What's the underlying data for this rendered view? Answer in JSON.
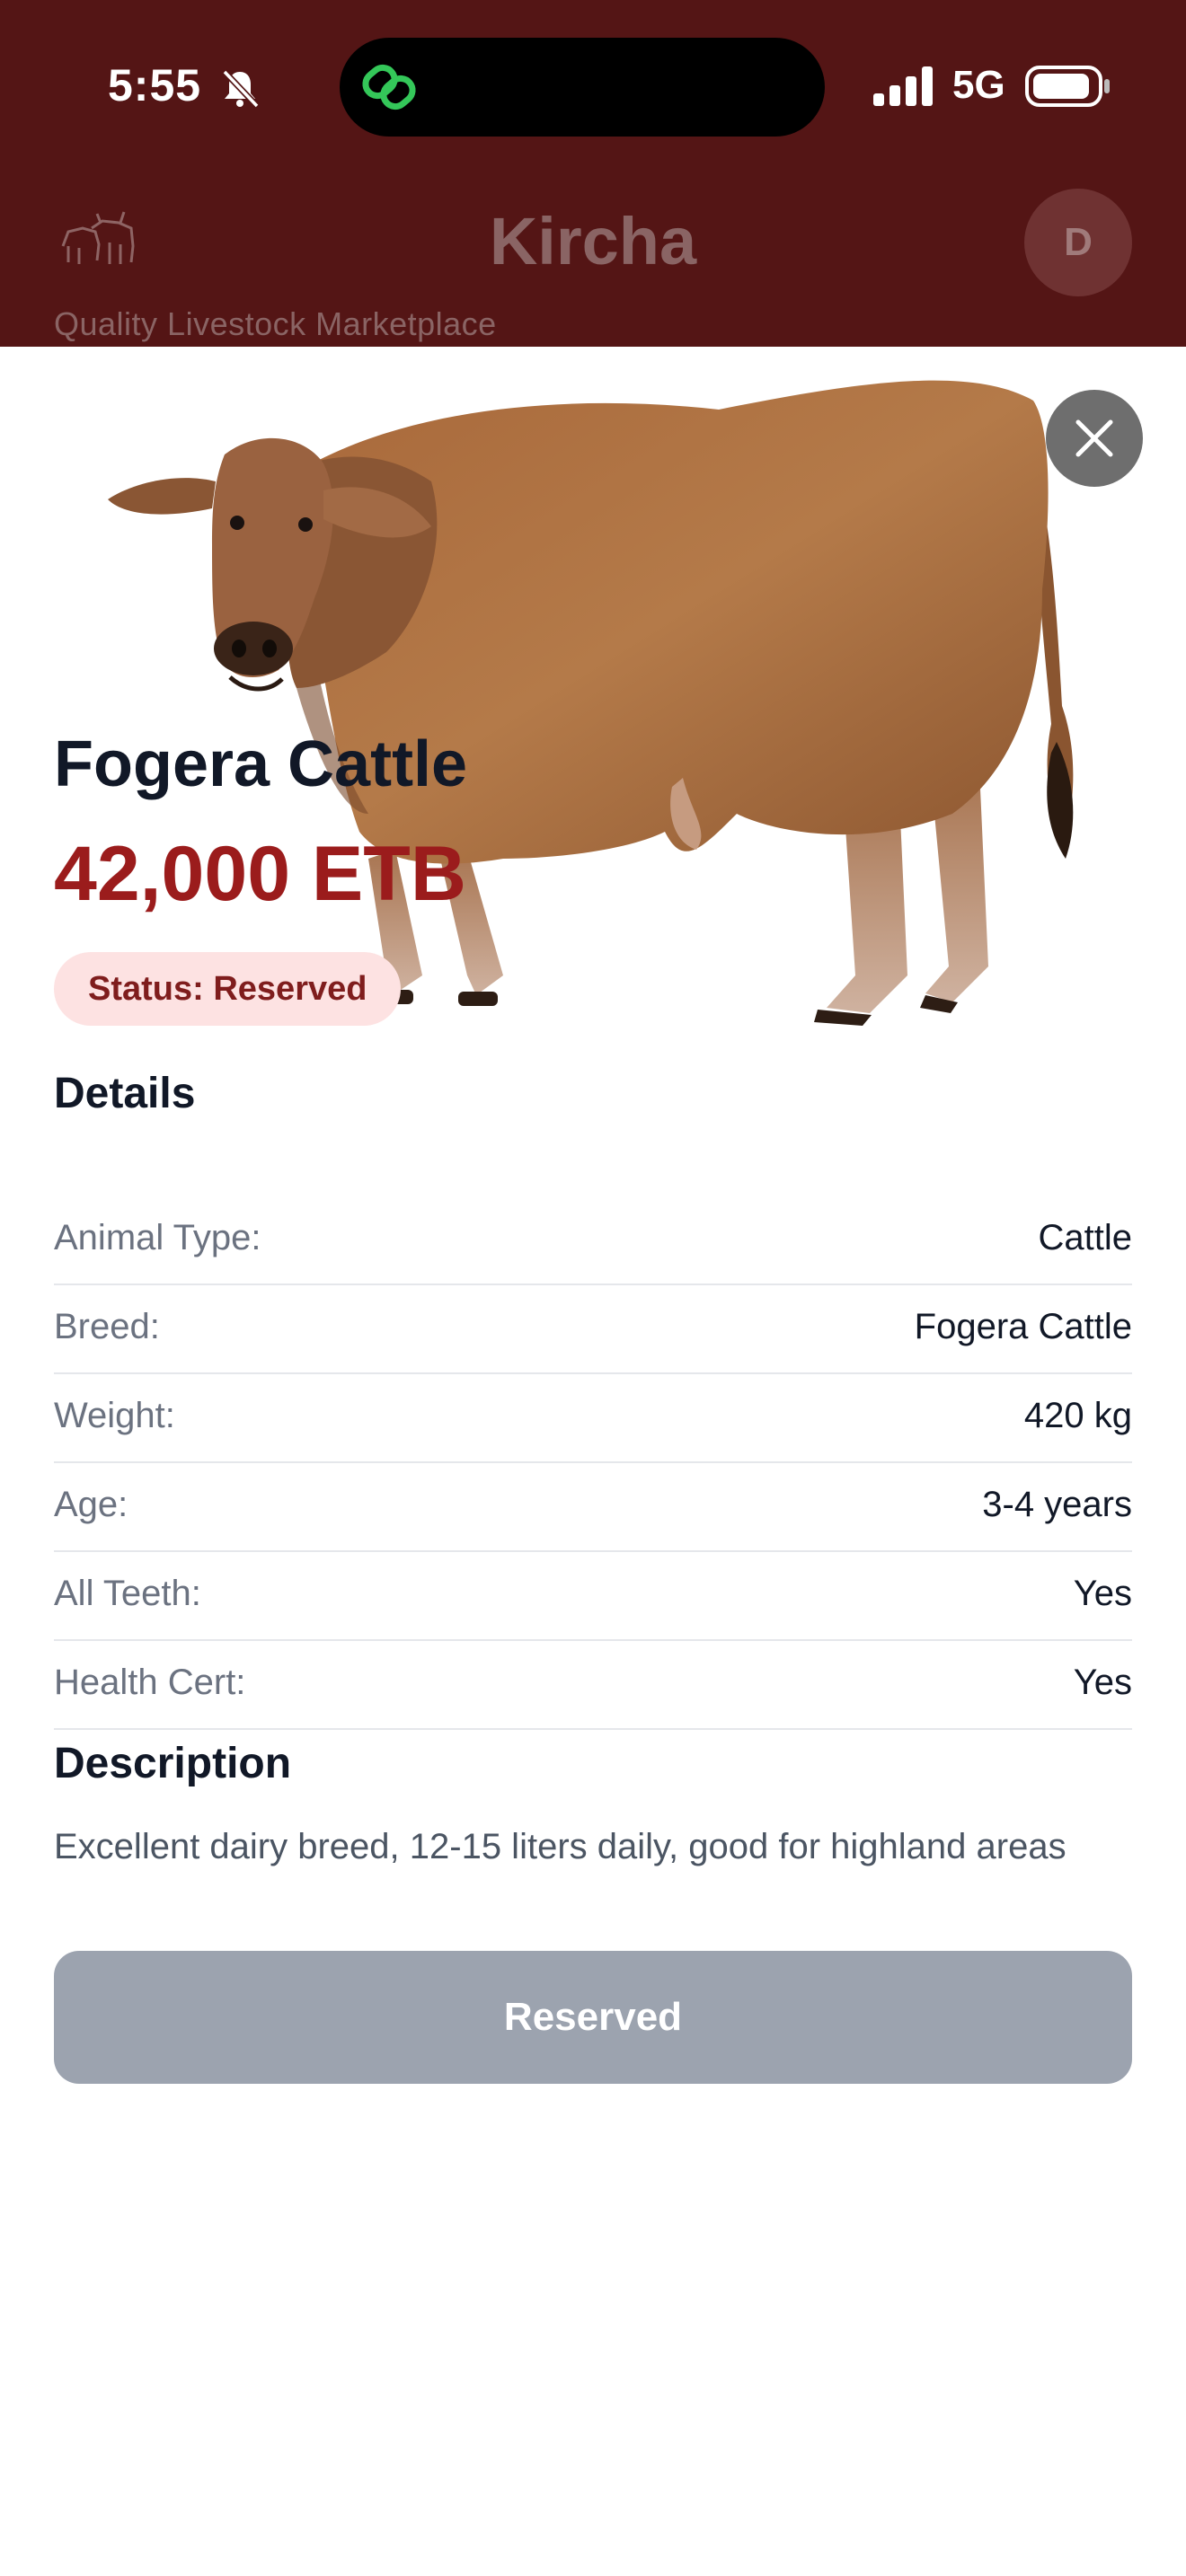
{
  "status_bar": {
    "time": "5:55",
    "network": "5G",
    "icons": [
      "bell-slash-icon",
      "link-icon",
      "signal-bars-icon",
      "battery-icon"
    ]
  },
  "header": {
    "title": "Kircha",
    "tagline": "Quality Livestock Marketplace",
    "avatar_initial": "D",
    "logo_icon": "livestock-logo-icon",
    "colors": {
      "background": "#541515"
    }
  },
  "listing": {
    "name": "Fogera Cattle",
    "price": "42,000 ETB",
    "status": "Status: Reserved",
    "image_icon": "cattle-photo",
    "close_icon": "close-icon",
    "details_title": "Details",
    "details": [
      {
        "label": "Animal Type:",
        "value": "Cattle"
      },
      {
        "label": "Breed:",
        "value": "Fogera Cattle"
      },
      {
        "label": "Weight:",
        "value": "420 kg"
      },
      {
        "label": "Age:",
        "value": "3-4 years"
      },
      {
        "label": "All Teeth:",
        "value": "Yes"
      },
      {
        "label": "Health Cert:",
        "value": "Yes"
      }
    ],
    "description_title": "Description",
    "description": "Excellent dairy breed, 12-15 liters daily, good for highland areas",
    "action_label": "Reserved",
    "colors": {
      "price": "#9b1c1c",
      "badge_bg": "#fde2e2",
      "badge_text": "#7f1d1d",
      "button_disabled": "#9ca3af"
    }
  }
}
